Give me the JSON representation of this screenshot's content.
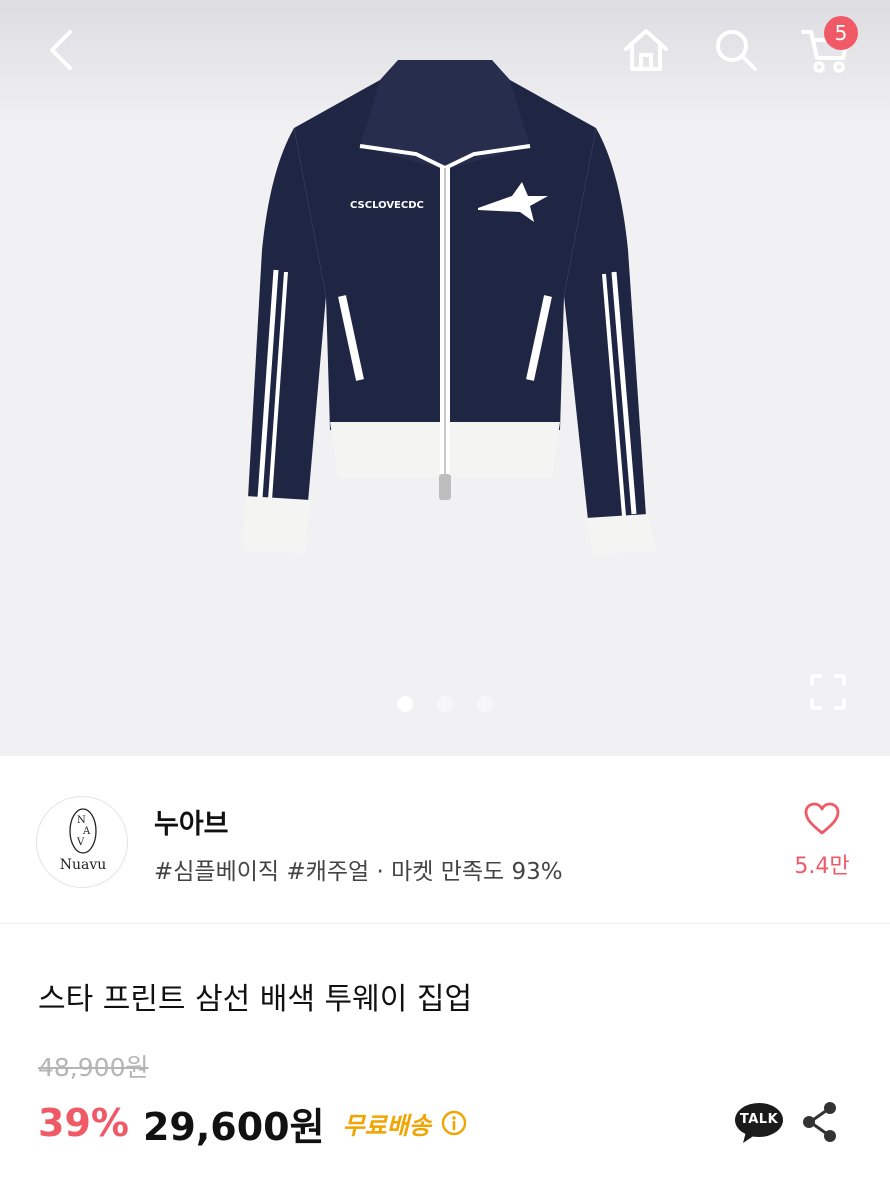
{
  "header": {
    "cart_count": "5"
  },
  "hero": {
    "jacket_print": "CSCLOVECDC",
    "slide_count": 3,
    "active_slide": 1
  },
  "shop": {
    "logo_text": "Nuavu",
    "name": "누아브",
    "tags": "#심플베이직 #캐주얼 · 마켓 만족도 93%",
    "like_count": "5.4만"
  },
  "product": {
    "title": "스타 프린트 삼선 배색 투웨이 집업",
    "original_price": "48,900원",
    "discount": "39%",
    "price": "29,600원",
    "shipping": "무료배송",
    "talk_label": "TALK"
  },
  "colors": {
    "accent": "#f05a67",
    "shipping": "#f2a400",
    "kakao": "#fae100",
    "navy": "#1f2644"
  }
}
